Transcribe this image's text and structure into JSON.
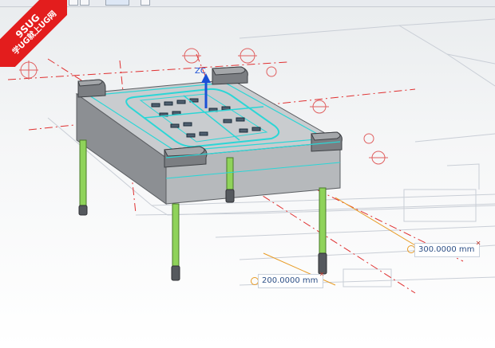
{
  "watermark": {
    "line1": "9SUG",
    "line2": "学UG就上UG网"
  },
  "axis": {
    "label": "ZC"
  },
  "dimensions": [
    {
      "value": "300.0000 mm"
    },
    {
      "value": "200.0000 mm"
    }
  ],
  "colors": {
    "accent_cyan": "#2bd6d6",
    "centerline_red": "#e03030",
    "pin_green": "#8fd35a",
    "plate_gray": "#a9acb0",
    "axis_blue": "#1a4fd6"
  }
}
